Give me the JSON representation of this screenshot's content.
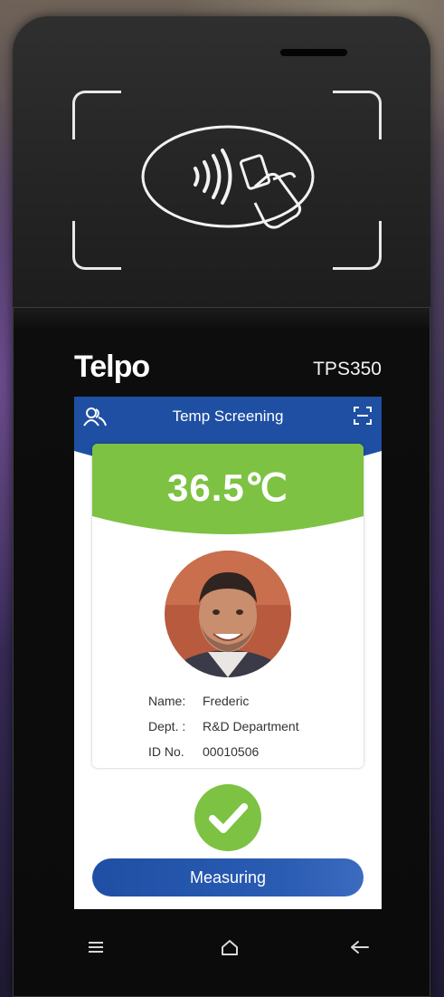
{
  "device": {
    "brand": "Telpo",
    "model": "TPS350"
  },
  "screen": {
    "header": {
      "title": "Temp Screening",
      "left_icon": "users-icon",
      "right_icon": "scan-icon"
    },
    "temperature": "36.5℃",
    "person": {
      "name_label": "Name:",
      "name_value": "Frederic",
      "dept_label": "Dept. :",
      "dept_value": "R&D Department",
      "id_label": "ID No.",
      "id_value": "00010506"
    },
    "status_icon": "check-icon",
    "button_label": "Measuring"
  },
  "nav": [
    "menu-icon",
    "home-icon",
    "back-icon"
  ],
  "colors": {
    "header_blue": "#1e4fa3",
    "temp_green": "#7dc242",
    "button_blue": "#1f4fa5"
  }
}
